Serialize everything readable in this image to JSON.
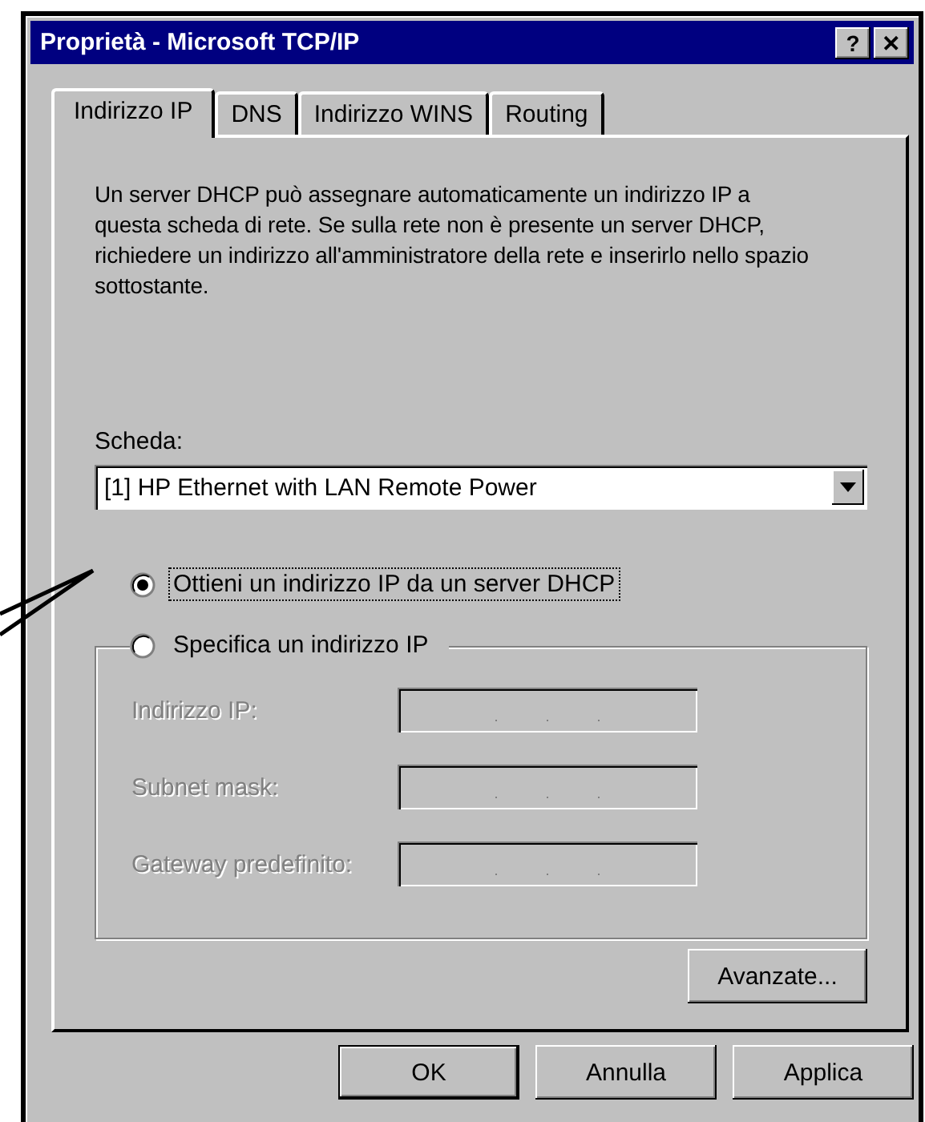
{
  "window": {
    "title": "Proprietà - Microsoft TCP/IP",
    "buttons": [
      "?",
      "✕"
    ]
  },
  "tabs": [
    {
      "label": "Indirizzo IP",
      "selected": true
    },
    {
      "label": "DNS",
      "selected": false
    },
    {
      "label": "Indirizzo WINS",
      "selected": false
    },
    {
      "label": "Routing",
      "selected": false
    }
  ],
  "description": "Un server DHCP può assegnare automaticamente un indirizzo IP a questa scheda di rete. Se sulla rete non è presente un server DHCP, richiedere un indirizzo all'amministratore della rete e inserirlo nello spazio sottostante.",
  "adapter": {
    "label": "Scheda:",
    "value": "[1] HP Ethernet with LAN Remote Power"
  },
  "options": [
    {
      "label": "Ottieni un indirizzo IP da un server DHCP",
      "selected": true,
      "focused": true
    },
    {
      "label": "Specifica un indirizzo IP",
      "selected": false,
      "focused": false
    }
  ],
  "fields": [
    {
      "label": "Indirizzo IP:",
      "disabled": true
    },
    {
      "label": "Subnet mask:",
      "disabled": true
    },
    {
      "label": "Gateway predefinito:",
      "disabled": true
    }
  ],
  "advanced_button": "Avanzate...",
  "buttons": [
    {
      "label": "OK",
      "default": true
    },
    {
      "label": "Annulla",
      "default": false
    },
    {
      "label": "Applica",
      "default": false
    }
  ]
}
